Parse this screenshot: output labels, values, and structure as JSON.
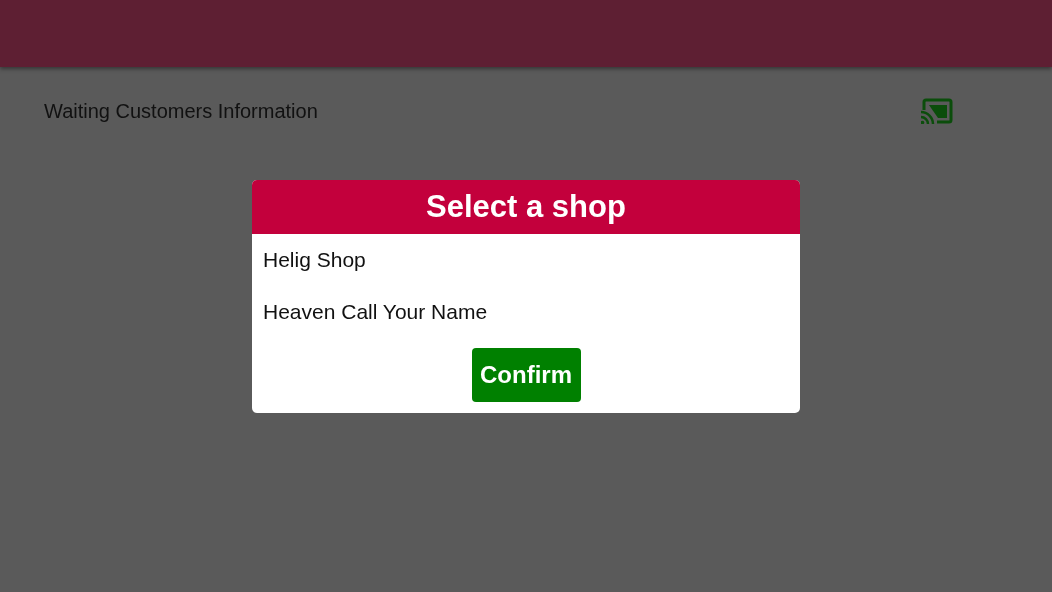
{
  "header": {
    "title": "Waiting Customers Information"
  },
  "dialog": {
    "title": "Select a shop",
    "shops": [
      {
        "name": "Helig Shop"
      },
      {
        "name": "Heaven Call Your Name"
      }
    ],
    "confirm_button": "Confirm"
  }
}
